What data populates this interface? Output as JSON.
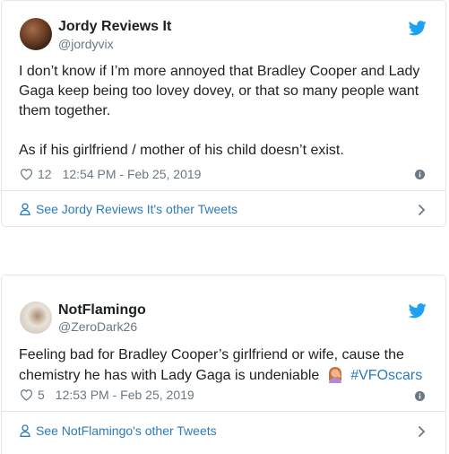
{
  "tweets": [
    {
      "display_name": "Jordy Reviews It",
      "handle": "@jordyvix",
      "text_lines": [
        "I don’t know if I’m more annoyed that Bradley Cooper and Lady Gaga keep being too lovey dovey, or that so many people want them together.",
        "As if his girlfriend / mother of his child doesn’t exist."
      ],
      "likes": "12",
      "timestamp": "12:54 PM - Feb 25, 2019",
      "footer_link": "See Jordy Reviews It's other Tweets"
    },
    {
      "display_name": "NotFlamingo",
      "handle": "@ZeroDark26",
      "text": "Feeling bad for Bradley Cooper’s girlfriend or wife, cause the chemistry he has with Lady Gaga is undeniable",
      "hashtag": "#VFOscars",
      "likes": "5",
      "timestamp": "12:53 PM - Feb 25, 2019",
      "footer_link": "See NotFlamingo's other Tweets"
    }
  ],
  "colors": {
    "link_blue": "#2b7bb9",
    "twitter_blue": "#1da1f2",
    "muted_gray": "#697882",
    "border": "#e1e8ed"
  },
  "icons": [
    "avatar",
    "twitter-bird-icon",
    "heart-icon",
    "info-icon",
    "person-icon",
    "chevron-right-icon",
    "woman-facepalming-emoji"
  ]
}
